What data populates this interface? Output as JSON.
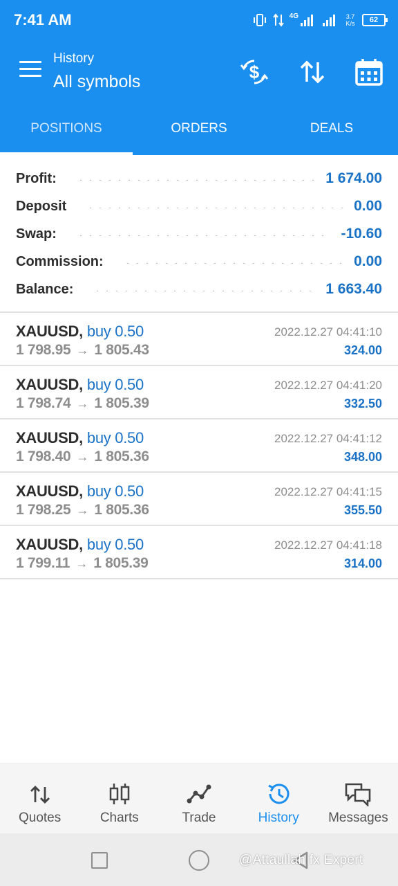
{
  "status_bar": {
    "time": "7:41 AM",
    "network": "4G",
    "net_speed_value": "3.7",
    "net_speed_unit": "K/s",
    "battery": "62"
  },
  "app_bar": {
    "subtitle": "History",
    "title": "All symbols",
    "actions": [
      "currency-exchange-icon",
      "sort-icon",
      "calendar-icon"
    ]
  },
  "tabs": [
    {
      "label": "POSITIONS",
      "active": true
    },
    {
      "label": "ORDERS",
      "active": false
    },
    {
      "label": "DEALS",
      "active": false
    }
  ],
  "summary": {
    "profit": {
      "label": "Profit:",
      "value": "1 674.00"
    },
    "deposit": {
      "label": "Deposit",
      "value": "0.00"
    },
    "swap": {
      "label": "Swap:",
      "value": "-10.60"
    },
    "commission": {
      "label": "Commission:",
      "value": "0.00"
    },
    "balance": {
      "label": "Balance:",
      "value": "1 663.40"
    }
  },
  "positions": [
    {
      "symbol": "XAUUSD,",
      "type": "buy 0.50",
      "open_price": "1 798.95",
      "close_price": "1 805.43",
      "time": "2022.12.27 04:41:10",
      "profit": "324.00"
    },
    {
      "symbol": "XAUUSD,",
      "type": "buy 0.50",
      "open_price": "1 798.74",
      "close_price": "1 805.39",
      "time": "2022.12.27 04:41:20",
      "profit": "332.50"
    },
    {
      "symbol": "XAUUSD,",
      "type": "buy 0.50",
      "open_price": "1 798.40",
      "close_price": "1 805.36",
      "time": "2022.12.27 04:41:12",
      "profit": "348.00"
    },
    {
      "symbol": "XAUUSD,",
      "type": "buy 0.50",
      "open_price": "1 798.25",
      "close_price": "1 805.36",
      "time": "2022.12.27 04:41:15",
      "profit": "355.50"
    },
    {
      "symbol": "XAUUSD,",
      "type": "buy 0.50",
      "open_price": "1 799.11",
      "close_price": "1 805.39",
      "time": "2022.12.27 04:41:18",
      "profit": "314.00"
    }
  ],
  "price_arrow": "→",
  "bottom_nav": [
    {
      "label": "Quotes",
      "icon": "quotes-arrows-icon",
      "active": false
    },
    {
      "label": "Charts",
      "icon": "candlestick-icon",
      "active": false
    },
    {
      "label": "Trade",
      "icon": "trend-line-icon",
      "active": false
    },
    {
      "label": "History",
      "icon": "history-clock-icon",
      "active": true
    },
    {
      "label": "Messages",
      "icon": "chat-bubbles-icon",
      "active": false
    }
  ],
  "watermark": "@Attaullah fx Expert",
  "colors": {
    "primary": "#1a8ff0",
    "value_blue": "#1a72c7",
    "muted_text": "#8d8d8d",
    "dark_text": "#2d2d2d"
  }
}
